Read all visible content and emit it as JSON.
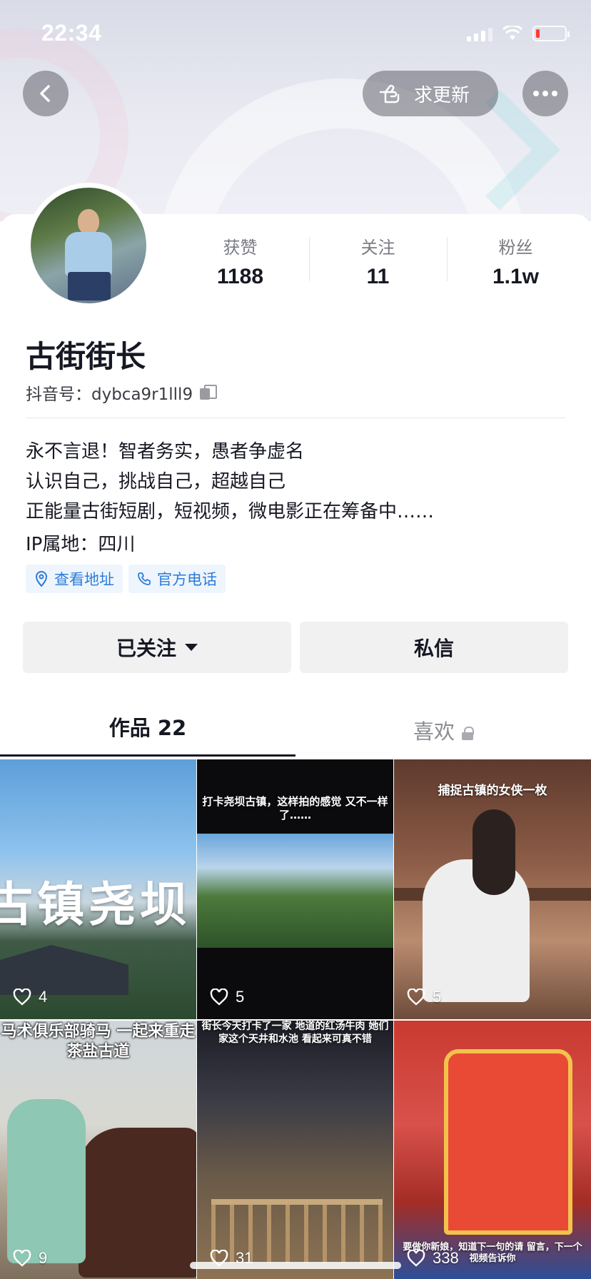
{
  "status_bar": {
    "time": "22:34"
  },
  "top_bar": {
    "update_label": "求更新"
  },
  "profile": {
    "nickname": "古街街长",
    "douyin_id": "抖音号：dybca9r1lll9",
    "stats": [
      {
        "label": "获赞",
        "value": "1188"
      },
      {
        "label": "关注",
        "value": "11"
      },
      {
        "label": "粉丝",
        "value": "1.1w"
      }
    ],
    "bio_lines": [
      "永不言退！智者务实，愚者争虚名",
      "认识自己，挑战自己，超越自己",
      "正能量古街短剧，短视频，微电影正在筹备中……"
    ],
    "ip_location": "IP属地：四川",
    "tags": [
      "查看地址",
      "官方电话"
    ]
  },
  "actions": {
    "follow_label": "已关注",
    "message_label": "私信"
  },
  "tabs": {
    "works_label": "作品 22",
    "likes_label": "喜欢"
  },
  "videos": [
    {
      "likes": "4",
      "overlay_text": "古镇尧坝"
    },
    {
      "likes": "5",
      "overlay_text": "打卡尧坝古镇，这样拍的感觉 又不一样了……"
    },
    {
      "likes": "5",
      "overlay_text": "捕捉古镇的女侠一枚"
    },
    {
      "likes": "9",
      "overlay_text": "马术俱乐部骑马 一起来重走 茶盐古道"
    },
    {
      "likes": "31",
      "overlay_text": "街长今天打卡了一家 地道的红汤牛肉 她们家这个天井和水池 看起来可真不错"
    },
    {
      "likes": "338",
      "overlay_text": "要做你新娘，知道下一句的请 留言，下一个视频告诉你"
    }
  ],
  "colors": {
    "accent_blue": "#2b7bd9",
    "text_primary": "#161823",
    "battery_low": "#ff3b30"
  }
}
